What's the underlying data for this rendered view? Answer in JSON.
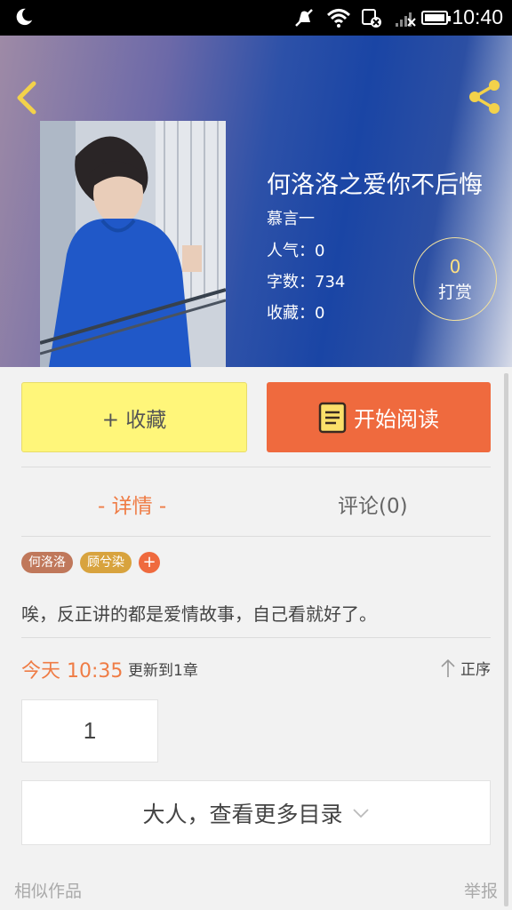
{
  "status_bar": {
    "time": "10:40",
    "icons": [
      "moon-icon",
      "mute-icon",
      "wifi-icon",
      "sim-off-icon",
      "signal-icon",
      "battery-icon"
    ]
  },
  "book": {
    "title": "何洛洛之爱你不后悔",
    "author": "慕言一",
    "popularity": "人气：0",
    "word_count": "字数：734",
    "favorites": "收藏：0"
  },
  "reward": {
    "count": "0",
    "label": "打赏"
  },
  "actions": {
    "collect_label": "+ 收藏",
    "read_label": "开始阅读"
  },
  "tabs": [
    {
      "label": "- 详情 -",
      "active": true
    },
    {
      "label": "评论(0)",
      "active": false
    }
  ],
  "tags": [
    "何洛洛",
    "顾兮染"
  ],
  "tag_add": "+",
  "summary": "唉，反正讲的都是爱情故事，自己看就好了。",
  "update": {
    "time": "今天 10:35",
    "text": "更新到1章"
  },
  "order_label": "正序",
  "chapters": [
    "1"
  ],
  "more_catalog": "大人，查看更多目录",
  "footer": {
    "similar": "相似作品",
    "report": "举报"
  },
  "colors": {
    "accent": "#ef6a3e",
    "collect": "#fff67a",
    "header_blue": "#1a45a5"
  }
}
